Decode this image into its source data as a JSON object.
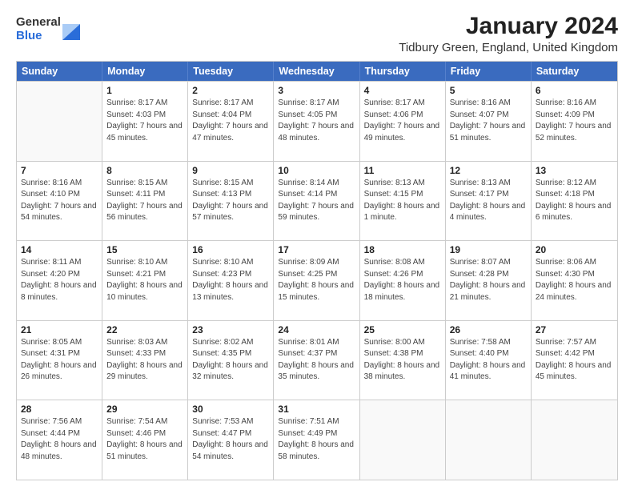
{
  "logo": {
    "general": "General",
    "blue": "Blue"
  },
  "title": "January 2024",
  "subtitle": "Tidbury Green, England, United Kingdom",
  "days": [
    "Sunday",
    "Monday",
    "Tuesday",
    "Wednesday",
    "Thursday",
    "Friday",
    "Saturday"
  ],
  "weeks": [
    [
      {
        "day": "",
        "sunrise": "",
        "sunset": "",
        "daylight": ""
      },
      {
        "day": "1",
        "sunrise": "Sunrise: 8:17 AM",
        "sunset": "Sunset: 4:03 PM",
        "daylight": "Daylight: 7 hours and 45 minutes."
      },
      {
        "day": "2",
        "sunrise": "Sunrise: 8:17 AM",
        "sunset": "Sunset: 4:04 PM",
        "daylight": "Daylight: 7 hours and 47 minutes."
      },
      {
        "day": "3",
        "sunrise": "Sunrise: 8:17 AM",
        "sunset": "Sunset: 4:05 PM",
        "daylight": "Daylight: 7 hours and 48 minutes."
      },
      {
        "day": "4",
        "sunrise": "Sunrise: 8:17 AM",
        "sunset": "Sunset: 4:06 PM",
        "daylight": "Daylight: 7 hours and 49 minutes."
      },
      {
        "day": "5",
        "sunrise": "Sunrise: 8:16 AM",
        "sunset": "Sunset: 4:07 PM",
        "daylight": "Daylight: 7 hours and 51 minutes."
      },
      {
        "day": "6",
        "sunrise": "Sunrise: 8:16 AM",
        "sunset": "Sunset: 4:09 PM",
        "daylight": "Daylight: 7 hours and 52 minutes."
      }
    ],
    [
      {
        "day": "7",
        "sunrise": "Sunrise: 8:16 AM",
        "sunset": "Sunset: 4:10 PM",
        "daylight": "Daylight: 7 hours and 54 minutes."
      },
      {
        "day": "8",
        "sunrise": "Sunrise: 8:15 AM",
        "sunset": "Sunset: 4:11 PM",
        "daylight": "Daylight: 7 hours and 56 minutes."
      },
      {
        "day": "9",
        "sunrise": "Sunrise: 8:15 AM",
        "sunset": "Sunset: 4:13 PM",
        "daylight": "Daylight: 7 hours and 57 minutes."
      },
      {
        "day": "10",
        "sunrise": "Sunrise: 8:14 AM",
        "sunset": "Sunset: 4:14 PM",
        "daylight": "Daylight: 7 hours and 59 minutes."
      },
      {
        "day": "11",
        "sunrise": "Sunrise: 8:13 AM",
        "sunset": "Sunset: 4:15 PM",
        "daylight": "Daylight: 8 hours and 1 minute."
      },
      {
        "day": "12",
        "sunrise": "Sunrise: 8:13 AM",
        "sunset": "Sunset: 4:17 PM",
        "daylight": "Daylight: 8 hours and 4 minutes."
      },
      {
        "day": "13",
        "sunrise": "Sunrise: 8:12 AM",
        "sunset": "Sunset: 4:18 PM",
        "daylight": "Daylight: 8 hours and 6 minutes."
      }
    ],
    [
      {
        "day": "14",
        "sunrise": "Sunrise: 8:11 AM",
        "sunset": "Sunset: 4:20 PM",
        "daylight": "Daylight: 8 hours and 8 minutes."
      },
      {
        "day": "15",
        "sunrise": "Sunrise: 8:10 AM",
        "sunset": "Sunset: 4:21 PM",
        "daylight": "Daylight: 8 hours and 10 minutes."
      },
      {
        "day": "16",
        "sunrise": "Sunrise: 8:10 AM",
        "sunset": "Sunset: 4:23 PM",
        "daylight": "Daylight: 8 hours and 13 minutes."
      },
      {
        "day": "17",
        "sunrise": "Sunrise: 8:09 AM",
        "sunset": "Sunset: 4:25 PM",
        "daylight": "Daylight: 8 hours and 15 minutes."
      },
      {
        "day": "18",
        "sunrise": "Sunrise: 8:08 AM",
        "sunset": "Sunset: 4:26 PM",
        "daylight": "Daylight: 8 hours and 18 minutes."
      },
      {
        "day": "19",
        "sunrise": "Sunrise: 8:07 AM",
        "sunset": "Sunset: 4:28 PM",
        "daylight": "Daylight: 8 hours and 21 minutes."
      },
      {
        "day": "20",
        "sunrise": "Sunrise: 8:06 AM",
        "sunset": "Sunset: 4:30 PM",
        "daylight": "Daylight: 8 hours and 24 minutes."
      }
    ],
    [
      {
        "day": "21",
        "sunrise": "Sunrise: 8:05 AM",
        "sunset": "Sunset: 4:31 PM",
        "daylight": "Daylight: 8 hours and 26 minutes."
      },
      {
        "day": "22",
        "sunrise": "Sunrise: 8:03 AM",
        "sunset": "Sunset: 4:33 PM",
        "daylight": "Daylight: 8 hours and 29 minutes."
      },
      {
        "day": "23",
        "sunrise": "Sunrise: 8:02 AM",
        "sunset": "Sunset: 4:35 PM",
        "daylight": "Daylight: 8 hours and 32 minutes."
      },
      {
        "day": "24",
        "sunrise": "Sunrise: 8:01 AM",
        "sunset": "Sunset: 4:37 PM",
        "daylight": "Daylight: 8 hours and 35 minutes."
      },
      {
        "day": "25",
        "sunrise": "Sunrise: 8:00 AM",
        "sunset": "Sunset: 4:38 PM",
        "daylight": "Daylight: 8 hours and 38 minutes."
      },
      {
        "day": "26",
        "sunrise": "Sunrise: 7:58 AM",
        "sunset": "Sunset: 4:40 PM",
        "daylight": "Daylight: 8 hours and 41 minutes."
      },
      {
        "day": "27",
        "sunrise": "Sunrise: 7:57 AM",
        "sunset": "Sunset: 4:42 PM",
        "daylight": "Daylight: 8 hours and 45 minutes."
      }
    ],
    [
      {
        "day": "28",
        "sunrise": "Sunrise: 7:56 AM",
        "sunset": "Sunset: 4:44 PM",
        "daylight": "Daylight: 8 hours and 48 minutes."
      },
      {
        "day": "29",
        "sunrise": "Sunrise: 7:54 AM",
        "sunset": "Sunset: 4:46 PM",
        "daylight": "Daylight: 8 hours and 51 minutes."
      },
      {
        "day": "30",
        "sunrise": "Sunrise: 7:53 AM",
        "sunset": "Sunset: 4:47 PM",
        "daylight": "Daylight: 8 hours and 54 minutes."
      },
      {
        "day": "31",
        "sunrise": "Sunrise: 7:51 AM",
        "sunset": "Sunset: 4:49 PM",
        "daylight": "Daylight: 8 hours and 58 minutes."
      },
      {
        "day": "",
        "sunrise": "",
        "sunset": "",
        "daylight": ""
      },
      {
        "day": "",
        "sunrise": "",
        "sunset": "",
        "daylight": ""
      },
      {
        "day": "",
        "sunrise": "",
        "sunset": "",
        "daylight": ""
      }
    ]
  ]
}
